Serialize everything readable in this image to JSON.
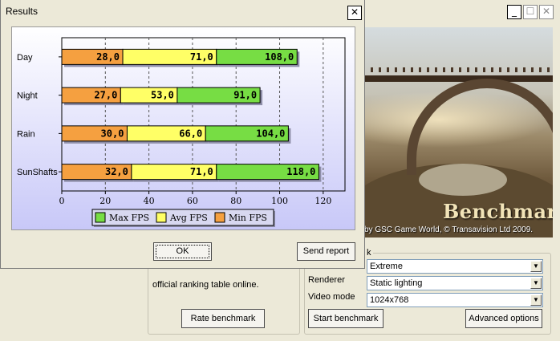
{
  "dialog": {
    "title": "Results",
    "close_glyph": "✕",
    "ok_label": "OK",
    "send_report_label": "Send report"
  },
  "chart_data": {
    "type": "bar",
    "orientation": "horizontal",
    "stacked": true,
    "categories": [
      "Day",
      "Night",
      "Rain",
      "SunShafts"
    ],
    "series": [
      {
        "name": "Min FPS",
        "values": [
          28.0,
          27.0,
          30.0,
          32.0
        ],
        "color": "#f5a040",
        "labels": [
          "28,0",
          "27,0",
          "30,0",
          "32,0"
        ]
      },
      {
        "name": "Avg FPS",
        "values": [
          71.0,
          53.0,
          66.0,
          71.0
        ],
        "color": "#ffff66",
        "labels": [
          "71,0",
          "53,0",
          "66,0",
          "71,0"
        ]
      },
      {
        "name": "Max FPS",
        "values": [
          108.0,
          91.0,
          104.0,
          118.0
        ],
        "color": "#77dd44",
        "labels": [
          "108,0",
          "91,0",
          "104,0",
          "118,0"
        ]
      }
    ],
    "x_ticks": [
      "0",
      "20",
      "40",
      "60",
      "80",
      "100",
      "120"
    ],
    "xlim": [
      0,
      130
    ],
    "grid": "vertical dashed",
    "legend": {
      "placement": "bottom-center",
      "order": [
        "Max FPS",
        "Avg FPS",
        "Min FPS"
      ]
    }
  },
  "background": {
    "window_controls": [
      "_",
      "☐",
      "✕"
    ],
    "scene_title": "Benchmark",
    "copyright": "by GSC Game World, © Transavision Ltd 2009.",
    "group_legend": "k",
    "quality_value": "Extreme",
    "renderer_label": "Renderer",
    "renderer_value": "Static lighting",
    "video_mode_label": "Video mode",
    "video_mode_value": "1024x768",
    "info_text": "official ranking table online.",
    "rate_button": "Rate benchmark",
    "start_button": "Start benchmark",
    "advanced_button": "Advanced options",
    "combo_arrow": "▼"
  }
}
